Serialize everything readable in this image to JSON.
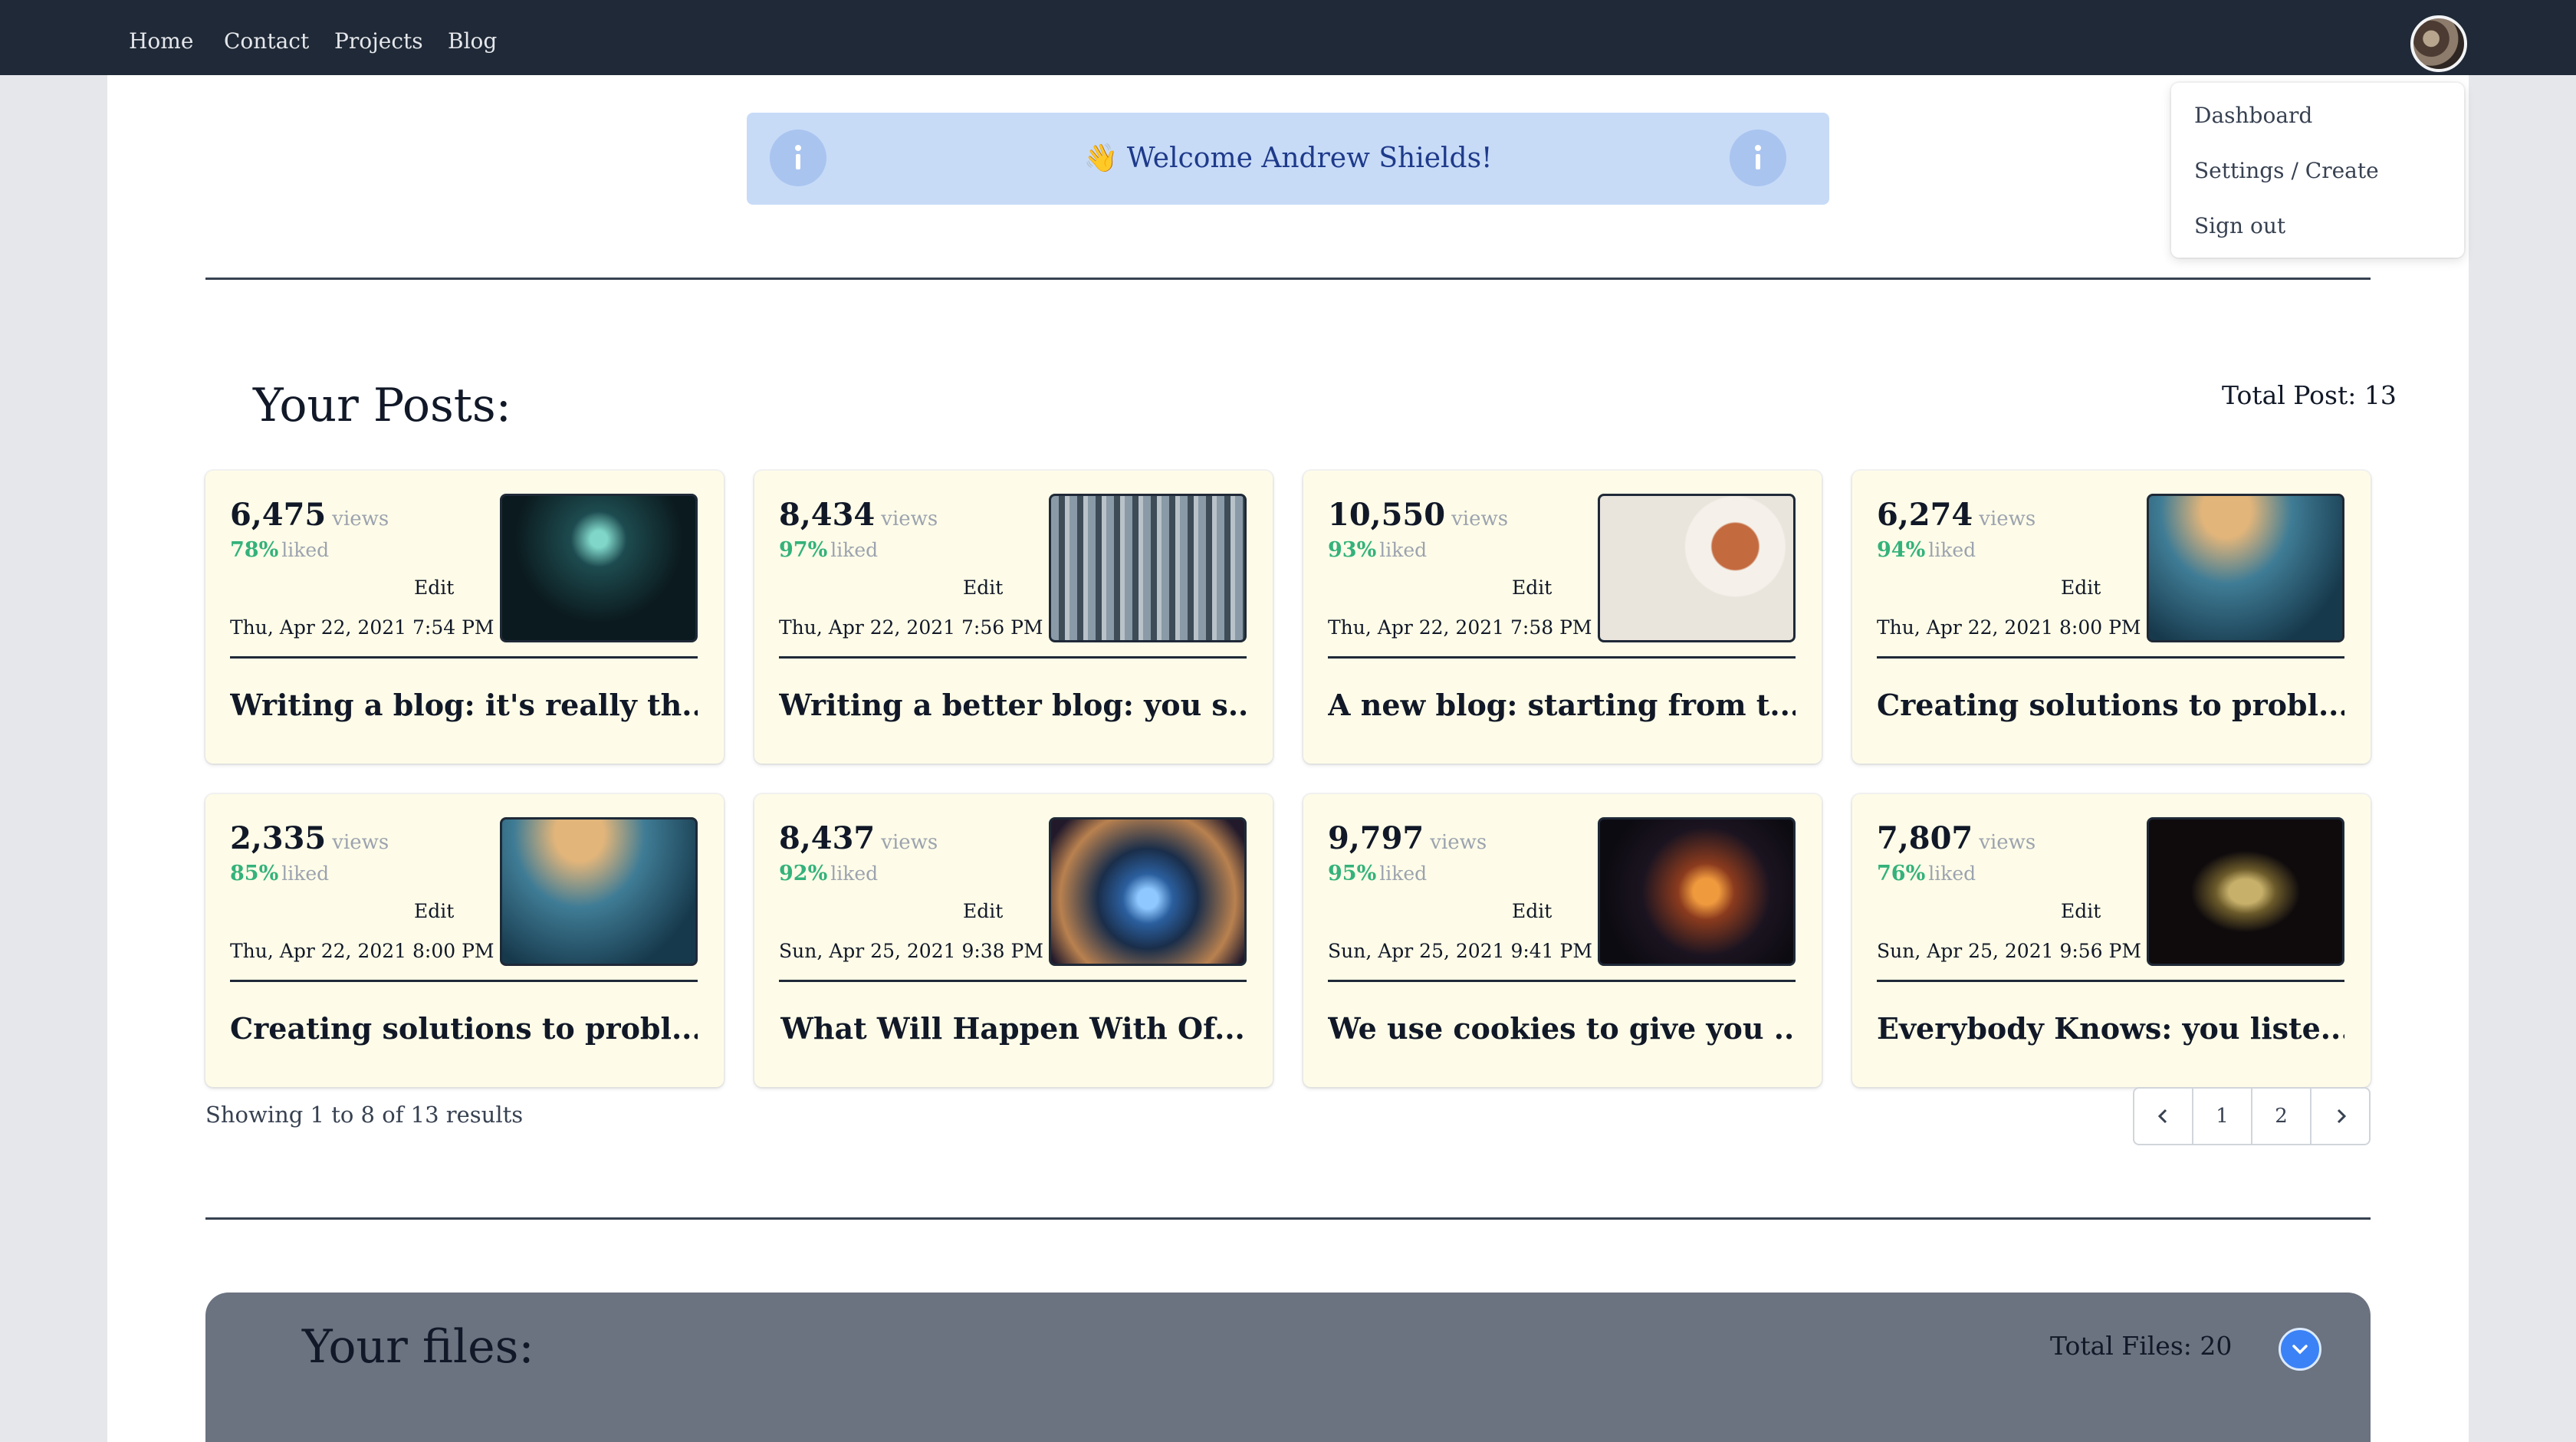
{
  "nav": {
    "links": [
      "Home",
      "Contact",
      "Projects",
      "Blog"
    ]
  },
  "user_menu": {
    "items": [
      "Dashboard",
      "Settings / Create",
      "Sign out"
    ]
  },
  "banner": {
    "text": "👋 Welcome Andrew Shields!"
  },
  "posts_section": {
    "title": "Your Posts:",
    "total": "Total Post: 13",
    "views_label": "views",
    "liked_label": "liked",
    "edit_label": "Edit",
    "cards": [
      {
        "views": "6,475",
        "liked": "78%",
        "date": "Thu, Apr 22, 2021 7:54 PM",
        "title": "Writing a blog: it's really th...",
        "image": "night-forest-cabin"
      },
      {
        "views": "8,434",
        "liked": "97%",
        "date": "Thu, Apr 22, 2021 7:56 PM",
        "title": "Writing a better blog: you s...",
        "image": "aerial-city"
      },
      {
        "views": "10,550",
        "liked": "93%",
        "date": "Thu, Apr 22, 2021 7:58 PM",
        "title": "A new blog: starting from t...",
        "image": "food-plates"
      },
      {
        "views": "6,274",
        "liked": "94%",
        "date": "Thu, Apr 22, 2021 8:00 PM",
        "title": "Creating solutions to probl...",
        "image": "underwater-diver"
      },
      {
        "views": "2,335",
        "liked": "85%",
        "date": "Thu, Apr 22, 2021 8:00 PM",
        "title": "Creating solutions to probl...",
        "image": "underwater-diver"
      },
      {
        "views": "8,437",
        "liked": "92%",
        "date": "Sun, Apr 25, 2021 9:38 PM",
        "title": "What Will Happen With Of...",
        "image": "bubble-nebula"
      },
      {
        "views": "9,797",
        "liked": "95%",
        "date": "Sun, Apr 25, 2021 9:41 PM",
        "title": "We use cookies to give you ...",
        "image": "orange-smoke"
      },
      {
        "views": "7,807",
        "liked": "76%",
        "date": "Sun, Apr 25, 2021 9:56 PM",
        "title": "Everybody Knows: you liste...",
        "image": "golden-rock"
      }
    ],
    "showing": "Showing 1 to 8 of 13 results",
    "pagination": {
      "prev": "‹",
      "pages": [
        "1",
        "2"
      ],
      "next": "›"
    }
  },
  "files_section": {
    "title": "Your files:",
    "total": "Total Files: 20"
  },
  "colors": {
    "nav_bg": "#1f2937",
    "card_bg": "#fefce8",
    "banner_bg": "#c7dbf7",
    "liked_green": "#34b27b",
    "files_panel": "#6b7280",
    "accent_blue": "#3b82f6"
  }
}
